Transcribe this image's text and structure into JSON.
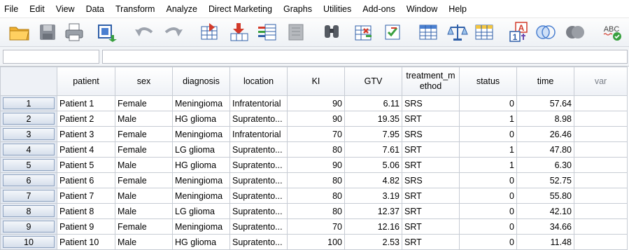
{
  "menu": [
    "File",
    "Edit",
    "View",
    "Data",
    "Transform",
    "Analyze",
    "Direct Marketing",
    "Graphs",
    "Utilities",
    "Add-ons",
    "Window",
    "Help"
  ],
  "toolbar": {
    "buttons": [
      "open-data-icon",
      "save-icon",
      "print-icon",
      "recall-dialogs-icon",
      "undo-icon",
      "redo-icon",
      "goto-case-icon",
      "goto-variable-icon",
      "variables-icon",
      "run-descriptives-icon",
      "find-icon",
      "insert-cases-icon",
      "insert-variable-icon",
      "split-file-icon",
      "weight-cases-icon",
      "select-cases-icon",
      "value-labels-icon",
      "use-variable-sets-icon",
      "show-all-variables-icon",
      "spell-check-icon"
    ],
    "value_labels_text": "A",
    "value_labels_num": "1",
    "spell_text": "ABC"
  },
  "cell_editor": {
    "cell_ref": "",
    "value": ""
  },
  "grid": {
    "columns": [
      "patient",
      "sex",
      "diagnosis",
      "location",
      "KI",
      "GTV",
      "treatment_method",
      "status",
      "time",
      "var"
    ],
    "rows": [
      {
        "n": "1",
        "patient": "Patient 1",
        "sex": "Female",
        "diagnosis": "Meningioma",
        "location": "Infratentorial",
        "KI": "90",
        "GTV": "6.11",
        "treatment_method": "SRS",
        "status": "0",
        "time": "57.64"
      },
      {
        "n": "2",
        "patient": "Patient 2",
        "sex": "Male",
        "diagnosis": "HG glioma",
        "location": "Supratento...",
        "KI": "90",
        "GTV": "19.35",
        "treatment_method": "SRT",
        "status": "1",
        "time": "8.98"
      },
      {
        "n": "3",
        "patient": "Patient 3",
        "sex": "Female",
        "diagnosis": "Meningioma",
        "location": "Infratentorial",
        "KI": "70",
        "GTV": "7.95",
        "treatment_method": "SRS",
        "status": "0",
        "time": "26.46"
      },
      {
        "n": "4",
        "patient": "Patient 4",
        "sex": "Female",
        "diagnosis": "LG glioma",
        "location": "Supratento...",
        "KI": "80",
        "GTV": "7.61",
        "treatment_method": "SRT",
        "status": "1",
        "time": "47.80"
      },
      {
        "n": "5",
        "patient": "Patient 5",
        "sex": "Male",
        "diagnosis": "HG glioma",
        "location": "Supratento...",
        "KI": "90",
        "GTV": "5.06",
        "treatment_method": "SRT",
        "status": "1",
        "time": "6.30"
      },
      {
        "n": "6",
        "patient": "Patient 6",
        "sex": "Female",
        "diagnosis": "Meningioma",
        "location": "Supratento...",
        "KI": "80",
        "GTV": "4.82",
        "treatment_method": "SRS",
        "status": "0",
        "time": "52.75"
      },
      {
        "n": "7",
        "patient": "Patient 7",
        "sex": "Male",
        "diagnosis": "Meningioma",
        "location": "Supratento...",
        "KI": "80",
        "GTV": "3.19",
        "treatment_method": "SRT",
        "status": "0",
        "time": "55.80"
      },
      {
        "n": "8",
        "patient": "Patient 8",
        "sex": "Male",
        "diagnosis": "LG glioma",
        "location": "Supratento...",
        "KI": "80",
        "GTV": "12.37",
        "treatment_method": "SRT",
        "status": "0",
        "time": "42.10"
      },
      {
        "n": "9",
        "patient": "Patient 9",
        "sex": "Female",
        "diagnosis": "Meningioma",
        "location": "Supratento...",
        "KI": "70",
        "GTV": "12.16",
        "treatment_method": "SRT",
        "status": "0",
        "time": "34.66"
      },
      {
        "n": "10",
        "patient": "Patient 10",
        "sex": "Male",
        "diagnosis": "HG glioma",
        "location": "Supratento...",
        "KI": "100",
        "GTV": "2.53",
        "treatment_method": "SRT",
        "status": "0",
        "time": "11.48"
      }
    ]
  }
}
